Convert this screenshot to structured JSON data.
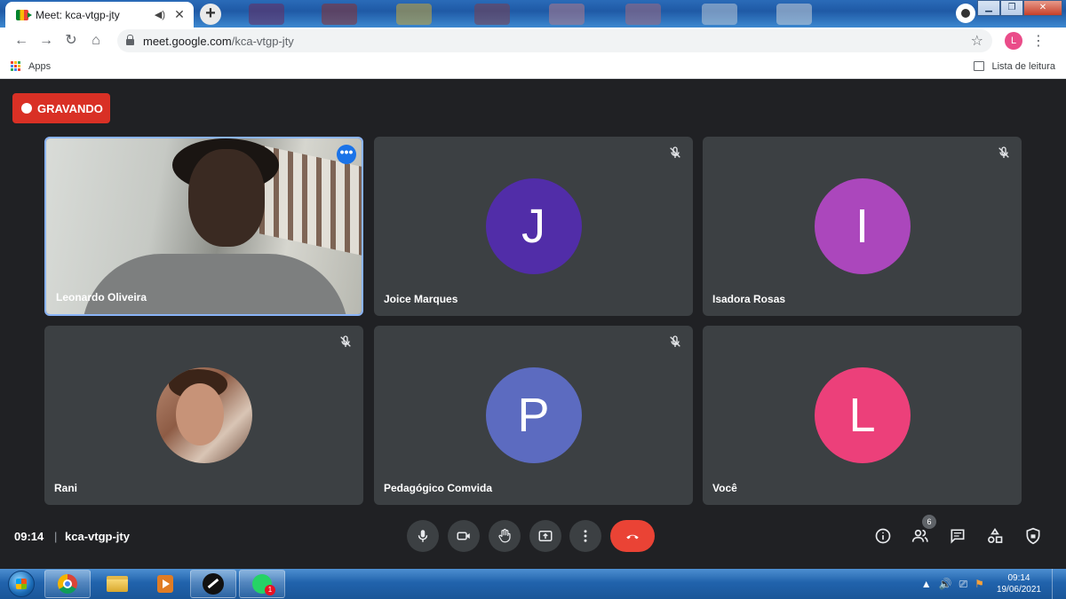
{
  "browser": {
    "tab_title": "Meet: kca-vtgp-jty",
    "url_host": "meet.google.com",
    "url_path": "/kca-vtgp-jty",
    "profile_initial": "L",
    "bookmarks": {
      "apps_label": "Apps",
      "reading_list_label": "Lista de leitura"
    }
  },
  "meet": {
    "recording_label": "GRAVANDO",
    "meeting_time": "09:14",
    "separator": "|",
    "meeting_code": "kca-vtgp-jty",
    "participant_count": "6",
    "more_options_glyph": "•••",
    "participants": [
      {
        "name": "Leonardo Oliveira",
        "type": "video",
        "active": true
      },
      {
        "name": "Joice Marques",
        "initial": "J",
        "color": "#512da8",
        "muted": true
      },
      {
        "name": "Isadora Rosas",
        "initial": "I",
        "color": "#ab47bc",
        "muted": true
      },
      {
        "name": "Rani",
        "type": "photo",
        "muted": true
      },
      {
        "name": "Pedagógico Comvida",
        "initial": "P",
        "color": "#5c6bc0",
        "muted": true
      },
      {
        "name": "Você",
        "initial": "L",
        "color": "#ec407a",
        "muted": false
      }
    ],
    "controls": [
      "mic-icon",
      "camera-icon",
      "raise-hand-icon",
      "present-screen-icon",
      "more-options-icon",
      "end-call-icon"
    ],
    "side_controls": [
      "info-icon",
      "people-icon",
      "chat-icon",
      "activities-icon",
      "host-controls-icon"
    ]
  },
  "taskbar": {
    "whatsapp_badge": "1",
    "clock_time": "09:14",
    "clock_date": "19/06/2021"
  }
}
